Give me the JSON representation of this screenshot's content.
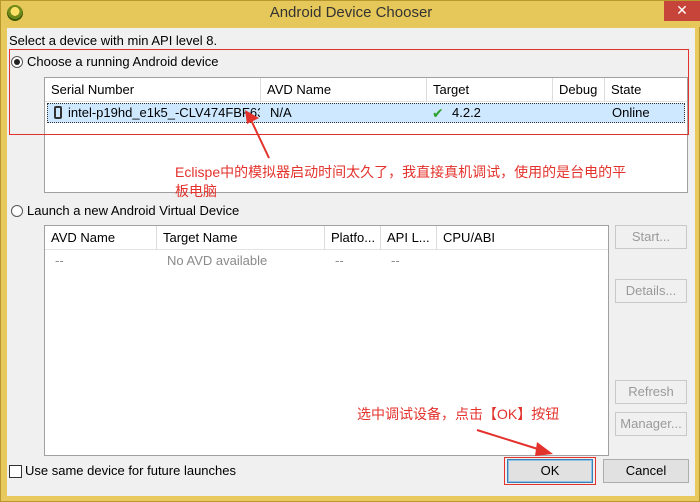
{
  "window": {
    "title": "Android Device Chooser",
    "close_glyph": "✕"
  },
  "prompt": "Select a device with min API level 8.",
  "running": {
    "label": "Choose a running Android device",
    "columns": [
      "Serial Number",
      "AVD Name",
      "Target",
      "Debug",
      "State"
    ],
    "rows": [
      {
        "serial": "intel-p19hd_e1k5_-CLV474FBF63",
        "avd": "N/A",
        "target": "4.2.2",
        "debug": "",
        "state": "Online",
        "icon": "phone-icon",
        "target_icon": "check-icon"
      }
    ]
  },
  "launch": {
    "label": "Launch a new Android Virtual Device",
    "columns": [
      "AVD Name",
      "Target Name",
      "Platfo...",
      "API L...",
      "CPU/ABI"
    ],
    "rows": [
      {
        "avd": "--",
        "target": "No AVD available",
        "platform": "--",
        "api": "--",
        "cpu": ""
      }
    ],
    "buttons": {
      "start": "Start...",
      "details": "Details...",
      "refresh": "Refresh",
      "manager": "Manager..."
    }
  },
  "footer": {
    "same_device_label": "Use same device for future launches",
    "ok": "OK",
    "cancel": "Cancel"
  },
  "annotations": {
    "note1": "Eclispe中的模拟器启动时间太久了，我直接真机调试，使用的是台电的平",
    "note1b": "板电脑",
    "note2": "选中调试设备，点击【OK】按钮"
  },
  "colors": {
    "annotation": "#e3322c",
    "selection": "#cde8ff",
    "title_bar": "#e6c85a"
  }
}
